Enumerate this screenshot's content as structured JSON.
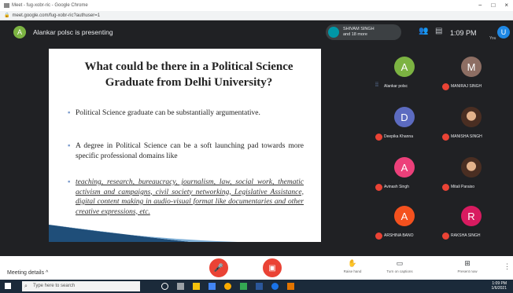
{
  "browser": {
    "title": "Meet - fug-xobr-ric - Google Chrome",
    "url": "meet.google.com/fug-xobr-ric?authuser=1",
    "controls": [
      "−",
      "□",
      "×"
    ]
  },
  "meet": {
    "presenter_initial": "A",
    "presenting_text": "Alankar polsc is presenting",
    "people_chip": {
      "line1": "SHIVAM SINGH",
      "line2": "and 18 more"
    },
    "clock": "1:09 PM",
    "user_initial": "U",
    "user_label": "You"
  },
  "slide": {
    "title": "What could be there in a Political Science Graduate from Delhi University?",
    "bullets": [
      "Political Science graduate can be substantially argumentative.",
      "A degree in Political Science can be a soft launching pad towards more specific professional domains like",
      "teaching, research, bureaucracy, journalism, law, social work, thematic activism and campaigns, civil society networking, Legislative Assistance, digital content making in audio-visual format like documentaries and other creative expressions, etc."
    ],
    "bullet_marker": "▪"
  },
  "participants": [
    {
      "initial": "A",
      "name": "Alankar polsc",
      "color": "#7cb342",
      "mic": "on"
    },
    {
      "initial": "M",
      "name": "MANIRAJ SINGH",
      "color": "#8d6e63",
      "mic": "off"
    },
    {
      "initial": "D",
      "name": "Deepika Khanna",
      "color": "#5c6bc0",
      "mic": "off"
    },
    {
      "initial": "",
      "name": "MANISHA SINGH",
      "color": "",
      "mic": "off",
      "photo": true
    },
    {
      "initial": "A",
      "name": "Avinash Singh",
      "color": "#ec407a",
      "mic": "off"
    },
    {
      "initial": "",
      "name": "Mitali Paraiso",
      "color": "",
      "mic": "off",
      "photo": true
    },
    {
      "initial": "A",
      "name": "ARSHINA BANO",
      "color": "#f4511e",
      "mic": "off"
    },
    {
      "initial": "R",
      "name": "RAKSHA SINGH",
      "color": "#d81b60",
      "mic": "off"
    }
  ],
  "controls": {
    "meeting_details": "Meeting details  ^",
    "raise_hand": "Raise hand",
    "captions": "Turn on captions",
    "present": "Present now"
  },
  "taskbar": {
    "search_placeholder": "Type here to search",
    "tray_time": "1:09 PM",
    "tray_date": "1/6/2021"
  },
  "colors": {
    "meet_bg": "#202124",
    "red": "#ea4335",
    "slide_accent": "#1f4e79"
  }
}
